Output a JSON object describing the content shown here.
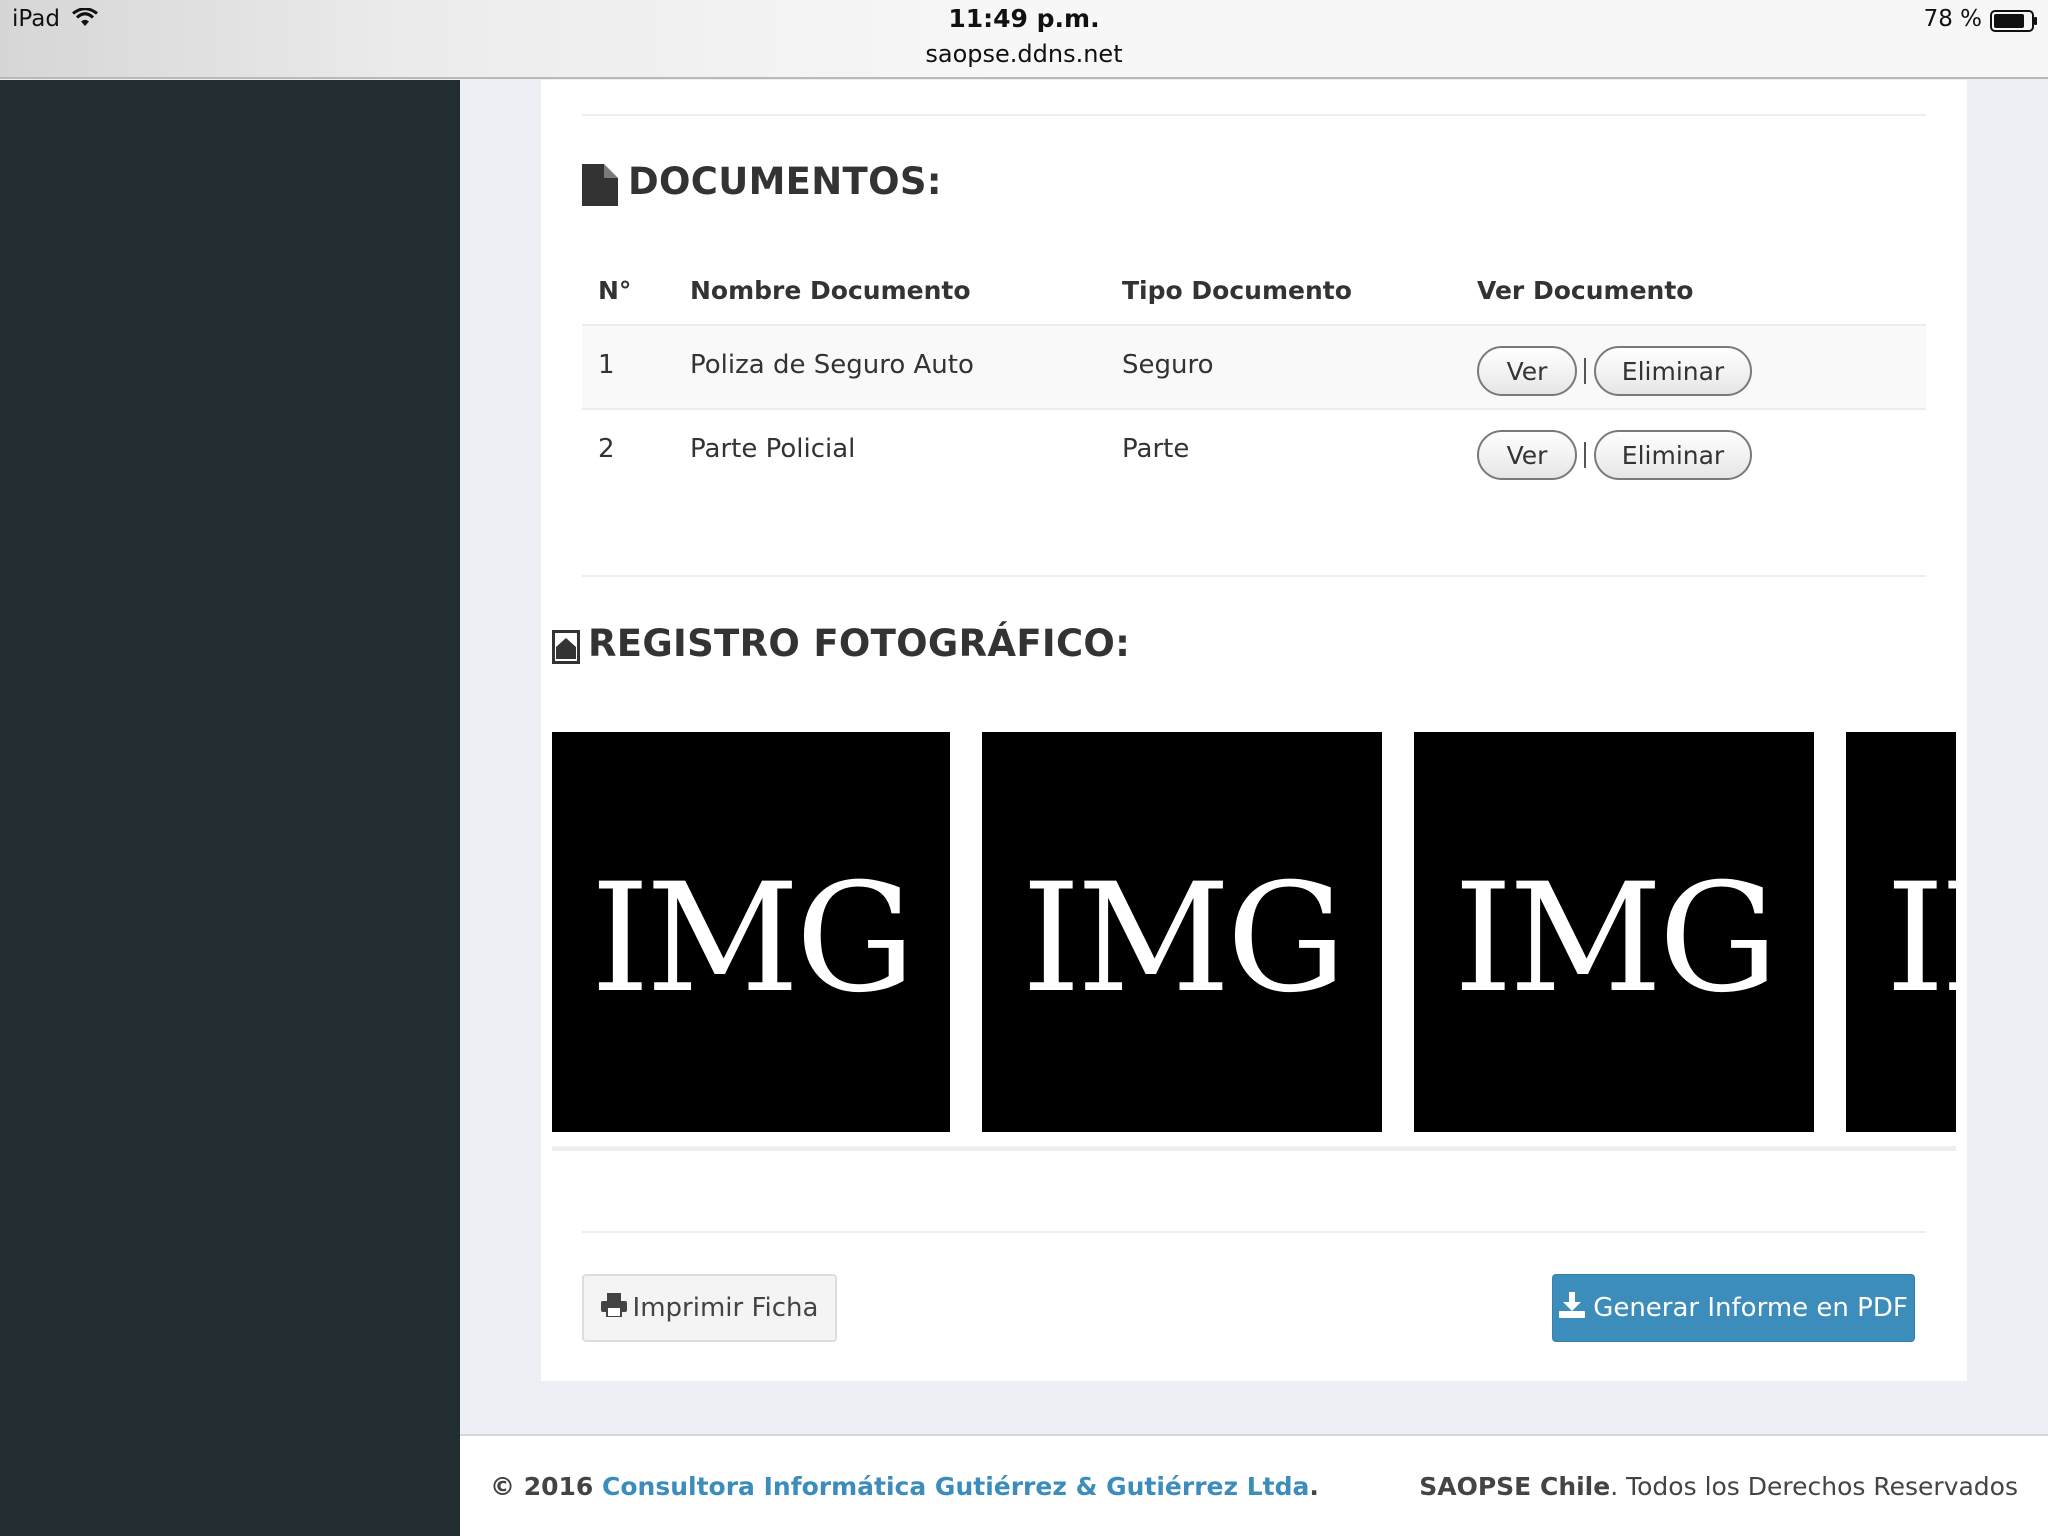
{
  "statusbar": {
    "device": "iPad",
    "time": "11:49 p.m.",
    "url": "saopse.ddns.net",
    "battery": "78 %"
  },
  "documents": {
    "title": "DOCUMENTOS:",
    "headers": [
      "N°",
      "Nombre Documento",
      "Tipo Documento",
      "Ver Documento"
    ],
    "rows": [
      {
        "num": "1",
        "name": "Poliza de Seguro Auto",
        "type": "Seguro",
        "view_label": "Ver",
        "delete_label": "Eliminar"
      },
      {
        "num": "2",
        "name": "Parte Policial",
        "type": "Parte",
        "view_label": "Ver",
        "delete_label": "Eliminar"
      }
    ]
  },
  "photos": {
    "title": "REGISTRO FOTOGRÁFICO:",
    "placeholder_text": "IMG",
    "count_visible": 4
  },
  "actions": {
    "print_label": "Imprimir Ficha",
    "pdf_label": "Generar Informe en PDF"
  },
  "footer": {
    "copyright": "© 2016",
    "company": "Consultora Informática Gutiérrez & Gutiérrez Ltda",
    "period": ".",
    "brand": "SAOPSE Chile",
    "rights": ". Todos los Derechos Reservados"
  },
  "colors": {
    "sidebar": "#222d32",
    "primary": "#3c8dbc",
    "background": "#ecf0f5"
  }
}
